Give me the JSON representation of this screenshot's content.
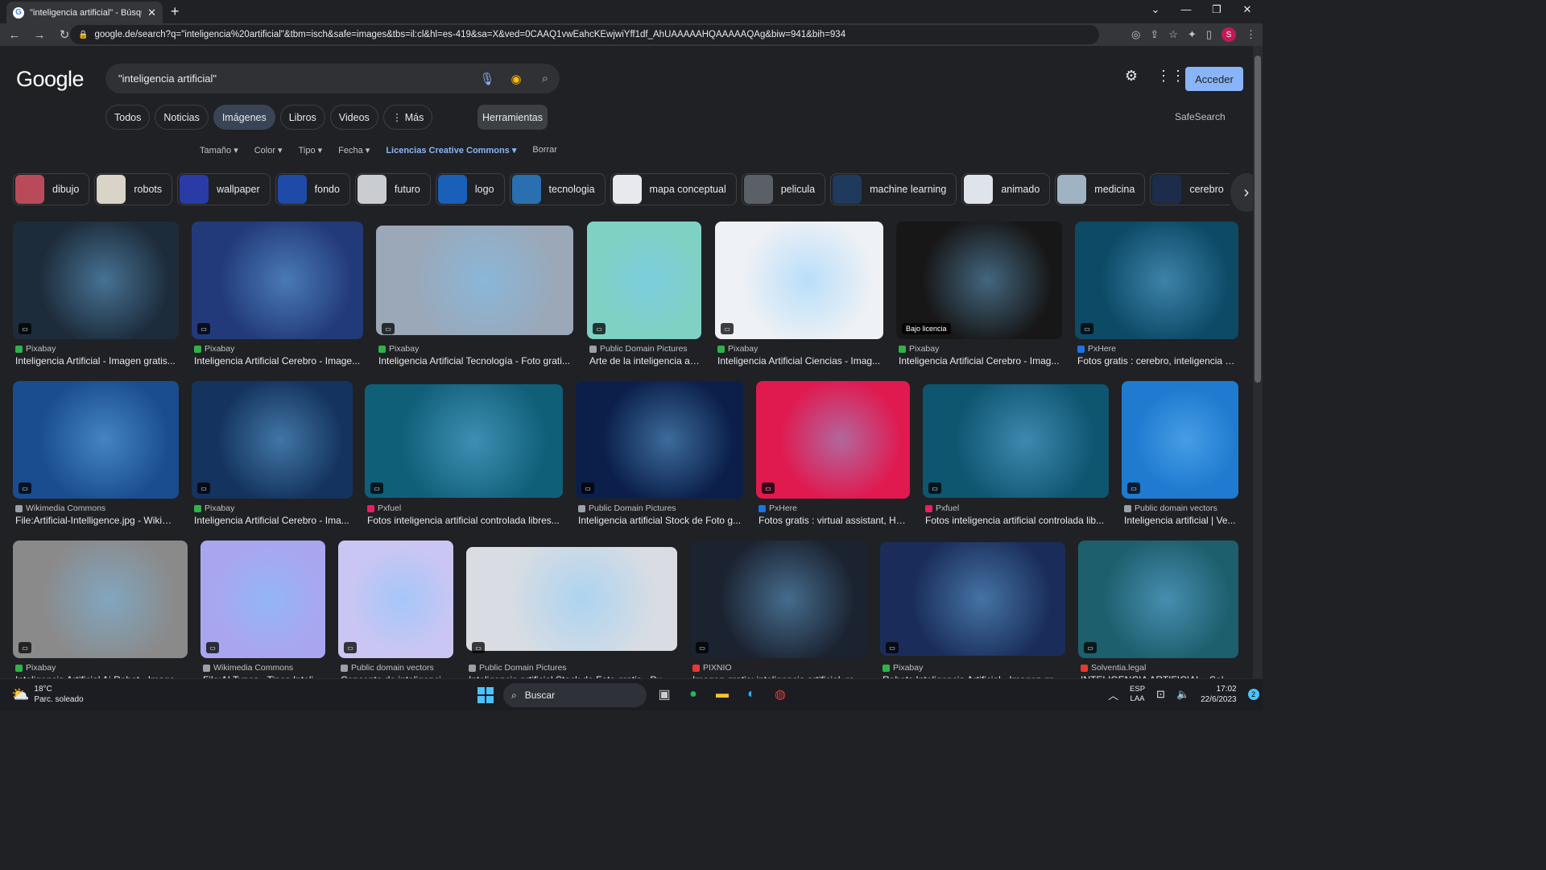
{
  "browser": {
    "tab_title": "\"inteligencia artificial\" - Búsqueda",
    "new_tab": "+",
    "window_controls": [
      "⌄",
      "—",
      "❐",
      "✕"
    ],
    "url": "google.de/search?q=\"inteligencia%20artificial\"&tbm=isch&safe=images&tbs=il:cl&hl=es-419&sa=X&ved=0CAAQ1vwEahcKEwjwiYff1df_AhUAAAAAHQAAAAAQAg&biw=941&bih=934",
    "profile_initial": "S"
  },
  "google": {
    "logo": "Google",
    "query": "\"inteligencia artificial\"",
    "login_label": "Acceder",
    "safesearch": "SafeSearch",
    "tools_label": "Herramientas",
    "tabs": [
      "Todos",
      "Noticias",
      "Imágenes",
      "Libros",
      "Videos",
      "⋮ Más"
    ],
    "active_tab": "Imágenes",
    "filters": [
      "Tamaño ▾",
      "Color ▾",
      "Tipo ▾",
      "Fecha ▾",
      "Licencias Creative Commons ▾",
      "Borrar"
    ],
    "active_filter": "Licencias Creative Commons ▾"
  },
  "related": [
    {
      "label": "dibujo",
      "color": "#b84a5a"
    },
    {
      "label": "robots",
      "color": "#d9d4c7"
    },
    {
      "label": "wallpaper",
      "color": "#2a3ba8"
    },
    {
      "label": "fondo",
      "color": "#1f4aa8"
    },
    {
      "label": "futuro",
      "color": "#c9ccd1"
    },
    {
      "label": "logo",
      "color": "#1a5fb8"
    },
    {
      "label": "tecnologia",
      "color": "#2a6fb0"
    },
    {
      "label": "mapa conceptual",
      "color": "#e7e9ee"
    },
    {
      "label": "pelicula",
      "color": "#5b5f66"
    },
    {
      "label": "machine learning",
      "color": "#1e3a5c"
    },
    {
      "label": "animado",
      "color": "#dfe3ea"
    },
    {
      "label": "medicina",
      "color": "#9fb3c2"
    },
    {
      "label": "cerebro",
      "color": "#1c2c4a"
    }
  ],
  "results": [
    {
      "source": "Pixabay",
      "title": "Inteligencia Artificial - Imagen gratis...",
      "color": "#1d2c3b",
      "srccolor": "#2fb24a",
      "license": ""
    },
    {
      "source": "Pixabay",
      "title": "Inteligencia Artificial Cerebro - Image...",
      "color": "#233a7a",
      "srccolor": "#2fb24a",
      "license": ""
    },
    {
      "source": "Pixabay",
      "title": "Inteligencia Artificial Tecnología - Foto grati...",
      "color": "#9aa8b8",
      "srccolor": "#2fb24a",
      "license": ""
    },
    {
      "source": "Public Domain Pictures",
      "title": "Arte de la inteligencia ar...",
      "color": "#7fd1c4",
      "srccolor": "#9aa0a6",
      "license": ""
    },
    {
      "source": "Pixabay",
      "title": "Inteligencia Artificial Ciencias - Imag...",
      "color": "#eef1f5",
      "srccolor": "#2fb24a",
      "license": ""
    },
    {
      "source": "Pixabay",
      "title": "Inteligencia Artificial Cerebro - Imag...",
      "color": "#171717",
      "srccolor": "#2fb24a",
      "license": "Bajo licencia"
    },
    {
      "source": "PxHere",
      "title": "Fotos gratis : cerebro, inteligencia a...",
      "color": "#0d4a66",
      "srccolor": "#1a73e8",
      "license": ""
    },
    {
      "source": "Wikimedia Commons",
      "title": "File:Artificial-Intelligence.jpg - Wikim...",
      "color": "#1a4d8f",
      "srccolor": "#9aa0a6",
      "license": ""
    },
    {
      "source": "Pixabay",
      "title": "Inteligencia Artificial Cerebro - Ima...",
      "color": "#14335e",
      "srccolor": "#2fb24a",
      "license": ""
    },
    {
      "source": "Pxfuel",
      "title": "Fotos inteligencia artificial controlada libres...",
      "color": "#0f5f78",
      "srccolor": "#e91e63",
      "license": ""
    },
    {
      "source": "Public Domain Pictures",
      "title": "Inteligencia artificial Stock de Foto g...",
      "color": "#0b1f4a",
      "srccolor": "#9aa0a6",
      "license": ""
    },
    {
      "source": "PxHere",
      "title": "Fotos gratis : virtual assistant, Ho...",
      "color": "#e0194f",
      "srccolor": "#1a73e8",
      "license": ""
    },
    {
      "source": "Pxfuel",
      "title": "Fotos inteligencia artificial controlada lib...",
      "color": "#0e5570",
      "srccolor": "#e91e63",
      "license": ""
    },
    {
      "source": "Public domain vectors",
      "title": "Inteligencia artificial | Ve...",
      "color": "#1f7ad0",
      "srccolor": "#9aa0a6",
      "license": ""
    },
    {
      "source": "Pixabay",
      "title": "Inteligencia Artificial Ai Robot - Image...",
      "color": "#8a8a8a",
      "srccolor": "#2fb24a",
      "license": ""
    },
    {
      "source": "Wikimedia Commons",
      "title": "File:AI Types - Tipos Intelig...",
      "color": "#a9a6f0",
      "srccolor": "#9aa0a6",
      "license": ""
    },
    {
      "source": "Public domain vectors",
      "title": "Concepto de inteligenci...",
      "color": "#c9c6f3",
      "srccolor": "#9aa0a6",
      "license": ""
    },
    {
      "source": "Public Domain Pictures",
      "title": "Inteligencia artificial Stock de Foto gratis - Publ...",
      "color": "#d9dde3",
      "srccolor": "#9aa0a6",
      "license": ""
    },
    {
      "source": "PIXNIO",
      "title": "Imagen gratis: inteligencia artificial, rea...",
      "color": "#1b2230",
      "srccolor": "#e53935",
      "license": ""
    },
    {
      "source": "Pixabay",
      "title": "Robots Inteligencia Artificial - Imagen gr...",
      "color": "#1a2d5a",
      "srccolor": "#2fb24a",
      "license": ""
    },
    {
      "source": "Solventia.legal",
      "title": "INTELIGENCIA ARTIFICIAL - Solve...",
      "color": "#1e5f6e",
      "srccolor": "#e53935",
      "license": ""
    }
  ],
  "taskbar": {
    "temp": "18°C",
    "weather": "Parc. soleado",
    "search": "Buscar",
    "lang1": "ESP",
    "lang2": "LAA",
    "time": "17:02",
    "date": "22/6/2023",
    "notifications": "2"
  }
}
